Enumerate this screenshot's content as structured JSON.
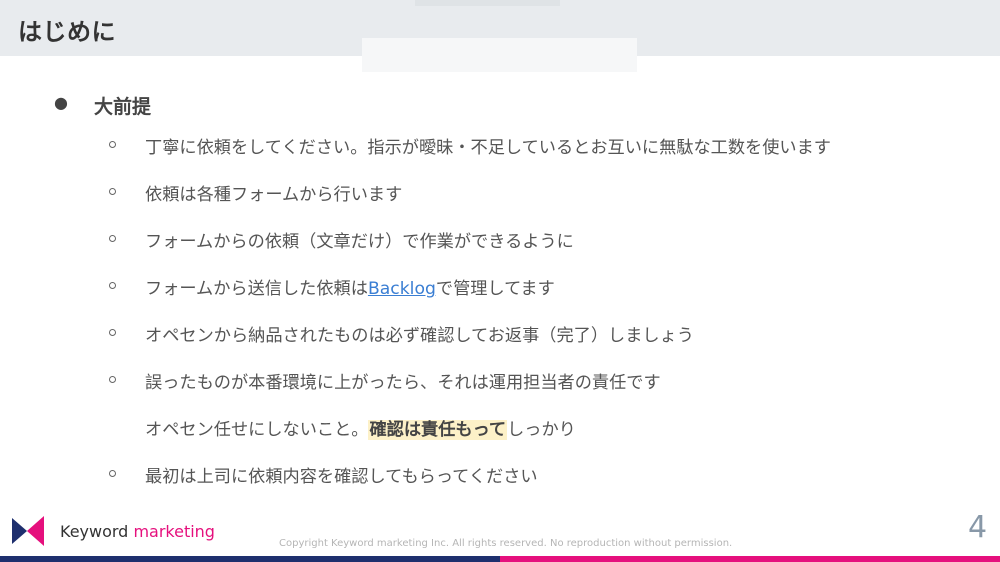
{
  "header": {
    "title": "はじめに"
  },
  "section": {
    "bullet": "●",
    "title": "大前提"
  },
  "items": [
    {
      "text": "丁寧に依頼をしてください。指示が曖昧・不足しているとお互いに無駄な工数を使います"
    },
    {
      "text": "依頼は各種フォームから行います"
    },
    {
      "text": "フォームからの依頼（文章だけ）で作業ができるように"
    },
    {
      "before": "フォームから送信した依頼は",
      "link": "Backlog",
      "after": "で管理してます"
    },
    {
      "text": "オペセンから納品されたものは必ず確認してお返事（完了）しましょう"
    },
    {
      "text": "誤ったものが本番環境に上がったら、それは運用担当者の責任です"
    },
    {
      "before": "オペセン任せにしないこと。",
      "highlight": "確認は責任もって",
      "after": "しっかり"
    },
    {
      "text": "最初は上司に依頼内容を確認してもらってください"
    }
  ],
  "footer": {
    "brand_main": "Keyword",
    "brand_accent": "marketing",
    "copyright": "Copyright Keyword marketing Inc. All rights reserved. No reproduction without permission.",
    "page_number": "4"
  },
  "colors": {
    "header_bg": "#e8ebee",
    "link": "#3a7ed3",
    "highlight": "#fdf1c8",
    "brand_navy": "#1e2f6e",
    "brand_pink": "#e5107d"
  }
}
